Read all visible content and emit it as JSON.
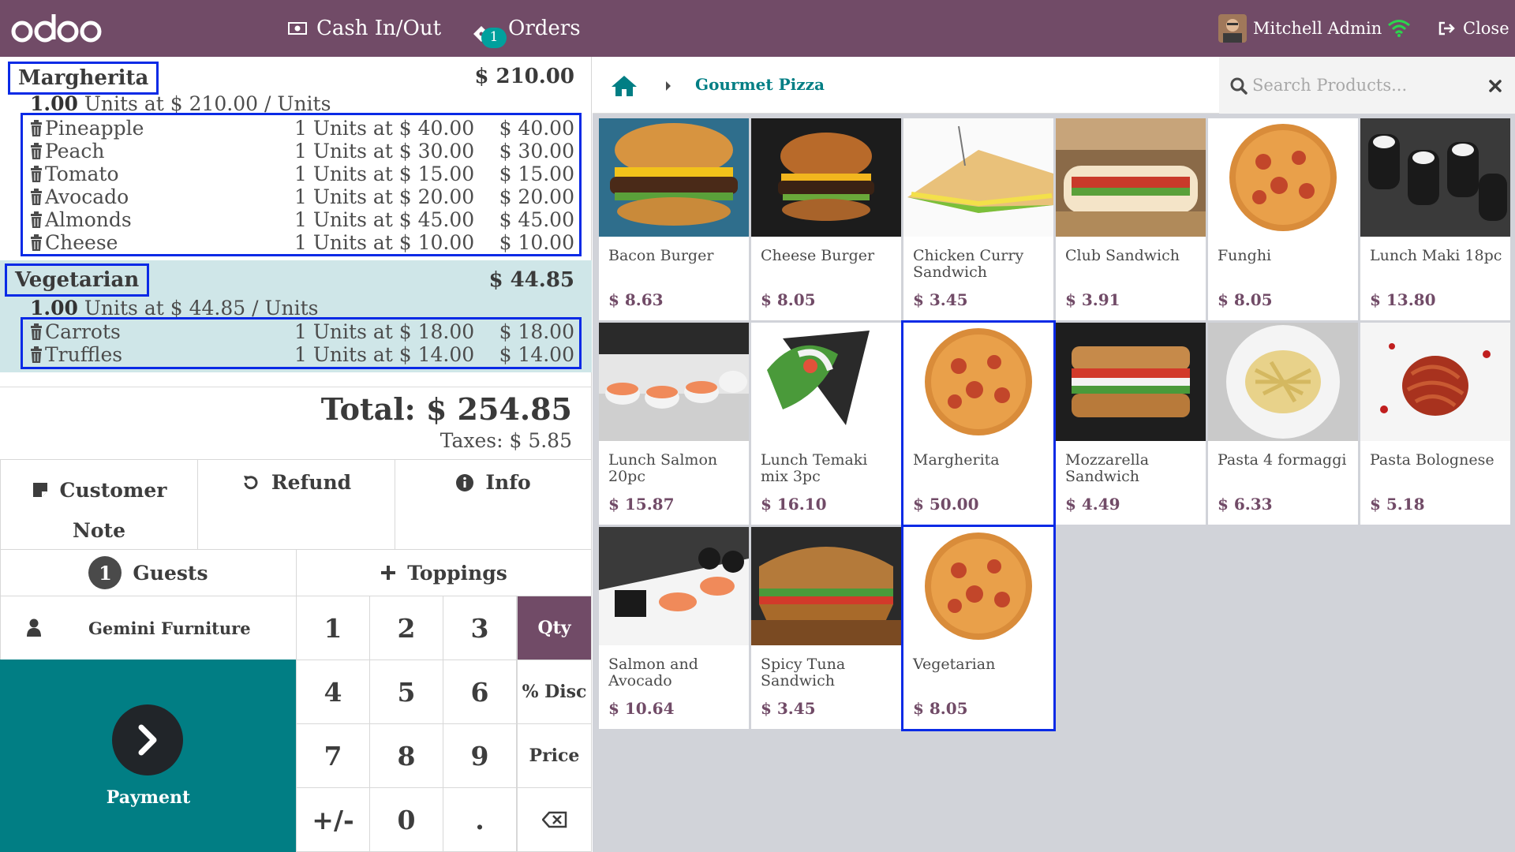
{
  "navbar": {
    "logo_text": "odoo",
    "cash_label": "Cash In/Out",
    "orders_label": "Orders",
    "orders_badge": "1",
    "user_name": "Mitchell Admin",
    "close_label": "Close"
  },
  "order": {
    "lines": [
      {
        "name": "Margherita",
        "price": "$ 210.00",
        "qty": "1.00",
        "unit_text": "Units at $ 210.00 / Units",
        "toppings": [
          {
            "name": "Pineapple",
            "units": "1 Units at $ 40.00",
            "total": "$ 40.00"
          },
          {
            "name": "Peach",
            "units": "1 Units at $ 30.00",
            "total": "$ 30.00"
          },
          {
            "name": "Tomato",
            "units": "1 Units at $ 15.00",
            "total": "$ 15.00"
          },
          {
            "name": "Avocado",
            "units": "1 Units at $ 20.00",
            "total": "$ 20.00"
          },
          {
            "name": "Almonds",
            "units": "1 Units at $ 45.00",
            "total": "$ 45.00"
          },
          {
            "name": "Cheese",
            "units": "1 Units at $ 10.00",
            "total": "$ 10.00"
          }
        ]
      },
      {
        "name": "Vegetarian",
        "price": "$ 44.85",
        "qty": "1.00",
        "unit_text": "Units at $ 44.85 / Units",
        "toppings": [
          {
            "name": "Carrots",
            "units": "1 Units at $ 18.00",
            "total": "$ 18.00"
          },
          {
            "name": "Truffles",
            "units": "1 Units at $ 14.00",
            "total": "$ 14.00"
          }
        ]
      }
    ],
    "total_label": "Total:",
    "total_value": "$ 254.85",
    "taxes_label": "Taxes:",
    "taxes_value": "$ 5.85"
  },
  "controls": {
    "customer_note_line1": "Customer",
    "customer_note_line2": "Note",
    "refund": "Refund",
    "info": "Info",
    "guests_count": "1",
    "guests": "Guests",
    "toppings": "Toppings",
    "customer": "Gemini Furniture",
    "payment": "Payment"
  },
  "numpad": {
    "keys": [
      "1",
      "2",
      "3",
      "4",
      "5",
      "6",
      "7",
      "8",
      "9",
      "+/-",
      "0",
      "."
    ],
    "modes": [
      "Qty",
      "% Disc",
      "Price"
    ],
    "active_mode": "Qty"
  },
  "products_panel": {
    "breadcrumb": "Gourmet Pizza",
    "search_placeholder": "Search Products...",
    "products": [
      {
        "name": "Bacon Burger",
        "price": "$ 8.63",
        "image": "burger"
      },
      {
        "name": "Cheese Burger",
        "price": "$ 8.05",
        "image": "burger"
      },
      {
        "name": "Chicken Curry Sandwich",
        "price": "$ 3.45",
        "image": "sandwich"
      },
      {
        "name": "Club Sandwich",
        "price": "$ 3.91",
        "image": "sandwich"
      },
      {
        "name": "Funghi",
        "price": "$ 8.05",
        "image": "pizza"
      },
      {
        "name": "Lunch Maki 18pc",
        "price": "$ 13.80",
        "image": "maki"
      },
      {
        "name": "Lunch Salmon 20pc",
        "price": "$ 15.87",
        "image": "sushi"
      },
      {
        "name": "Lunch Temaki mix 3pc",
        "price": "$ 16.10",
        "image": "temaki"
      },
      {
        "name": "Margherita",
        "price": "$ 50.00",
        "image": "pizza",
        "highlighted": true
      },
      {
        "name": "Mozzarella Sandwich",
        "price": "$ 4.49",
        "image": "sandwich"
      },
      {
        "name": "Pasta 4 formaggi",
        "price": "$ 6.33",
        "image": "pasta"
      },
      {
        "name": "Pasta Bolognese",
        "price": "$ 5.18",
        "image": "pasta"
      },
      {
        "name": "Salmon and Avocado",
        "price": "$ 10.64",
        "image": "sushi"
      },
      {
        "name": "Spicy Tuna Sandwich",
        "price": "$ 3.45",
        "image": "sandwich"
      },
      {
        "name": "Vegetarian",
        "price": "$ 8.05",
        "image": "pizza",
        "highlighted": true
      }
    ]
  },
  "colors": {
    "brand": "#714b67",
    "teal": "#017e84",
    "highlight_border": "#0a2ae6",
    "selected_line_bg": "#cfe6e8"
  }
}
